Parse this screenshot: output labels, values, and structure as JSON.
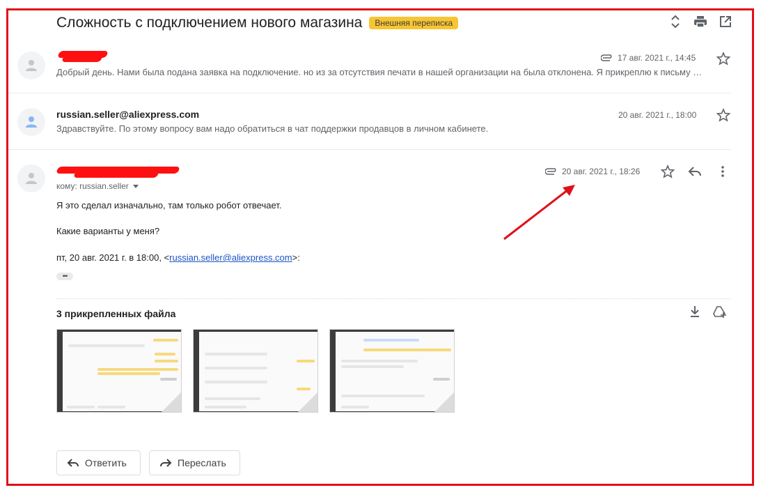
{
  "subject": {
    "title": "Сложность с подключением нового магазина",
    "label": "Внешняя переписка"
  },
  "top_icons": [
    "expand-collapse-icon",
    "print-icon",
    "open-in-new-window-icon"
  ],
  "messages": [
    {
      "sender_redacted": true,
      "date": "17 авг. 2021 г., 14:45",
      "has_attachment": true,
      "snippet": "Добрый день. Нами была подана заявка на подключение. но из за отсутствия печати в нашей организации на была отклонена. Я прикреплю к письму …"
    },
    {
      "sender": "russian.seller@aliexpress.com",
      "date": "20 авг. 2021 г., 18:00",
      "snippet": "Здравствуйте. По этому вопросу вам надо обратиться в чат поддержки продавцов в личном кабинете."
    },
    {
      "sender_redacted": true,
      "date": "20 авг. 2021 г., 18:26",
      "has_attachment": true,
      "to": "кому: russian.seller",
      "body": [
        "Я это сделал изначально, там только робот отвечает.",
        "Какие варианты у меня?"
      ],
      "quote_prefix": "пт, 20 авг. 2021 г. в 18:00, <",
      "quote_email": "russian.seller@aliexpress.com",
      "quote_suffix": ">:",
      "ellipsis": "•••",
      "attachments_title": "3 прикрепленных файла",
      "attachments": [
        {
          "name": "screenshot-1"
        },
        {
          "name": "screenshot-2"
        },
        {
          "name": "screenshot-3"
        }
      ]
    }
  ],
  "actions": {
    "reply": "Ответить",
    "forward": "Переслать"
  },
  "colors": {
    "label_bg": "#f7c531",
    "annotation_red": "#e0101a",
    "link": "#1a55c4"
  }
}
